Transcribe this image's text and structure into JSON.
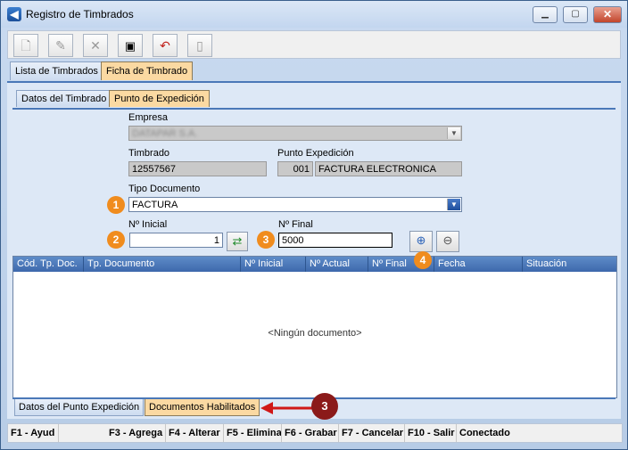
{
  "window": {
    "title": "Registro de Timbrados",
    "icon": "app-logo-icon",
    "controls": {
      "minimize": "▭",
      "maximize": "▣",
      "close": "✕"
    }
  },
  "toolbar": {
    "buttons": [
      {
        "name": "new-icon",
        "glyph": "🗋"
      },
      {
        "name": "edit-icon",
        "glyph": "✎"
      },
      {
        "name": "delete-icon",
        "glyph": "✕"
      },
      {
        "name": "save-icon",
        "glyph": "💾"
      },
      {
        "name": "undo-icon",
        "glyph": "↶"
      },
      {
        "name": "exit-icon",
        "glyph": "▯"
      }
    ]
  },
  "main_tabs": [
    "Lista de Timbrados",
    "Ficha de Timbrado"
  ],
  "sub_tabs": [
    "Datos del Timbrado",
    "Punto de Expedición"
  ],
  "form": {
    "empresa_label": "Empresa",
    "empresa_value": "DATAPAR S.A.",
    "timbrado_label": "Timbrado",
    "timbrado_value": "12557567",
    "punto_label": "Punto Expedición",
    "punto_code": "001",
    "punto_name": "FACTURA ELECTRONICA",
    "tipo_label": "Tipo Documento",
    "tipo_value": "FACTURA",
    "inicial_label": "Nº Inicial",
    "inicial_value": "1",
    "final_label": "Nº Final",
    "final_value": "5000"
  },
  "badges": [
    "1",
    "2",
    "3",
    "4",
    "3"
  ],
  "grid": {
    "columns": [
      "Cód. Tp. Doc.",
      "Tp. Documento",
      "Nº Inicial",
      "Nº Actual",
      "Nº Final",
      "Fecha",
      "Situación"
    ],
    "empty_text": "<Ningún documento>"
  },
  "bottom_tabs": [
    "Datos del Punto Expedición",
    "Documentos Habilitados"
  ],
  "status_bar": [
    "F1 - Ayud",
    "F3 - Agrega",
    "F4 - Alterar",
    "F5 - Elimina",
    "F6 - Grabar",
    "F7 - Cancelar",
    "F10 - Salir",
    "Conectado"
  ],
  "colors": {
    "badge_orange": "#f08c1e",
    "badge_dark": "#8b1a1a",
    "arrow_red": "#d01818",
    "selected_tab": "#fbd9a2"
  }
}
